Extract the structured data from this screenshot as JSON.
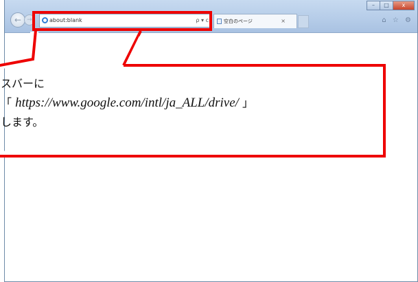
{
  "browser": {
    "address_text": "about:blank",
    "address_tools": "ρ ▾ c",
    "tab_title": "空白のページ",
    "tab_close": "×",
    "back_glyph": "←",
    "forward_glyph": "→",
    "window_controls": [
      "–",
      "□",
      "x"
    ],
    "toolbar_icons": "⌂ ☆ ⚙"
  },
  "callout": {
    "line1": "スバーに",
    "line2_open": "「",
    "line2_url": "https://www.google.com/intl/ja_ALL/drive/",
    "line2_close": "」",
    "line3": "します。"
  },
  "colors": {
    "highlight": "#ee0000",
    "frame": "#b5cce8"
  }
}
